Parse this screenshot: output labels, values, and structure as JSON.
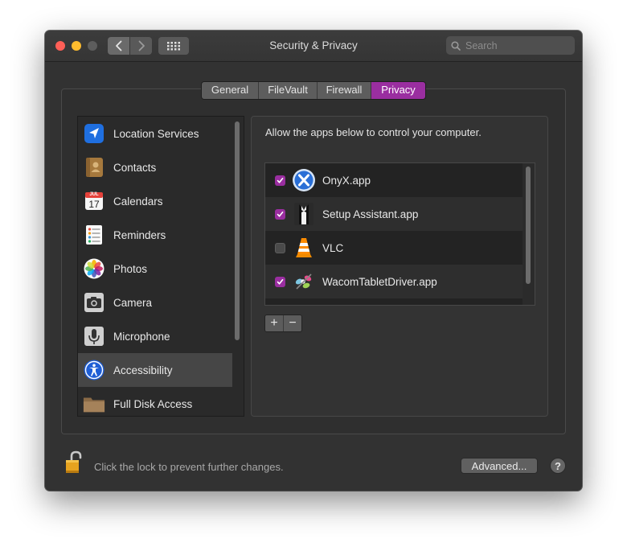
{
  "window": {
    "title": "Security & Privacy"
  },
  "search": {
    "placeholder": "Search"
  },
  "tabs": [
    {
      "label": "General",
      "active": false
    },
    {
      "label": "FileVault",
      "active": false
    },
    {
      "label": "Firewall",
      "active": false
    },
    {
      "label": "Privacy",
      "active": true
    }
  ],
  "sidebar": {
    "items": [
      {
        "label": "Location Services",
        "icon": "location-arrow-icon"
      },
      {
        "label": "Contacts",
        "icon": "contacts-book-icon"
      },
      {
        "label": "Calendars",
        "icon": "calendar-icon",
        "icon_text": "17",
        "icon_month": "JUL"
      },
      {
        "label": "Reminders",
        "icon": "reminders-list-icon"
      },
      {
        "label": "Photos",
        "icon": "photos-flower-icon"
      },
      {
        "label": "Camera",
        "icon": "camera-icon"
      },
      {
        "label": "Microphone",
        "icon": "microphone-icon"
      },
      {
        "label": "Accessibility",
        "icon": "accessibility-icon",
        "selected": true
      },
      {
        "label": "Full Disk Access",
        "icon": "folder-icon"
      }
    ]
  },
  "panel": {
    "description": "Allow the apps below to control your computer.",
    "apps": [
      {
        "label": "OnyX.app",
        "checked": true,
        "icon": "onyx-icon"
      },
      {
        "label": "Setup Assistant.app",
        "checked": true,
        "icon": "setup-assistant-icon"
      },
      {
        "label": "VLC",
        "checked": false,
        "icon": "vlc-cone-icon"
      },
      {
        "label": "WacomTabletDriver.app",
        "checked": true,
        "icon": "wacom-icon"
      }
    ],
    "add_label": "+",
    "remove_label": "−"
  },
  "footer": {
    "lock_text": "Click the lock to prevent further changes.",
    "advanced_label": "Advanced...",
    "help_label": "?"
  },
  "colors": {
    "accent": "#9a2ea0",
    "window_bg": "#323232",
    "close": "#ff5f57",
    "minimize": "#febc2e"
  }
}
